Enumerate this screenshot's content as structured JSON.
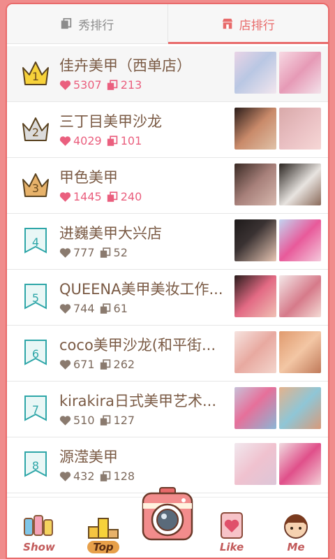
{
  "tabs": [
    {
      "label": "秀排行",
      "icon": "note-icon",
      "active": false
    },
    {
      "label": "店排行",
      "icon": "shop-icon",
      "active": true
    }
  ],
  "colors": {
    "accent": "#e86a6a",
    "hot": "#ea5f7e",
    "brown": "#7a5a44",
    "teal": "#2ea6a8"
  },
  "shops": [
    {
      "rank": "1",
      "name": "佳卉美甲（西单店）",
      "likes": "5307",
      "shows": "213",
      "badge": "crown-gold",
      "hot": true
    },
    {
      "rank": "2",
      "name": "三丁目美甲沙龙",
      "likes": "4029",
      "shows": "101",
      "badge": "crown-silver",
      "hot": true
    },
    {
      "rank": "3",
      "name": "甲色美甲",
      "likes": "1445",
      "shows": "240",
      "badge": "crown-bronze",
      "hot": true
    },
    {
      "rank": "4",
      "name": "进巍美甲大兴店",
      "likes": "777",
      "shows": "52",
      "badge": "ribbon",
      "hot": false
    },
    {
      "rank": "5",
      "name": "QUEENA美甲美妆工作...",
      "likes": "744",
      "shows": "61",
      "badge": "ribbon",
      "hot": false
    },
    {
      "rank": "6",
      "name": "coco美甲沙龙(和平街...",
      "likes": "671",
      "shows": "262",
      "badge": "ribbon",
      "hot": false
    },
    {
      "rank": "7",
      "name": "kirakira日式美甲艺术...",
      "likes": "510",
      "shows": "127",
      "badge": "ribbon",
      "hot": false
    },
    {
      "rank": "8",
      "name": "源滢美甲",
      "likes": "432",
      "shows": "128",
      "badge": "ribbon",
      "hot": false
    }
  ],
  "nav": [
    {
      "label": "Show",
      "icon": "nail-polish-icon"
    },
    {
      "label": "Top",
      "icon": "podium-icon",
      "active": true
    },
    {
      "label": "",
      "icon": "camera-icon"
    },
    {
      "label": "Like",
      "icon": "heart-card-icon"
    },
    {
      "label": "Me",
      "icon": "avatar-icon"
    }
  ]
}
